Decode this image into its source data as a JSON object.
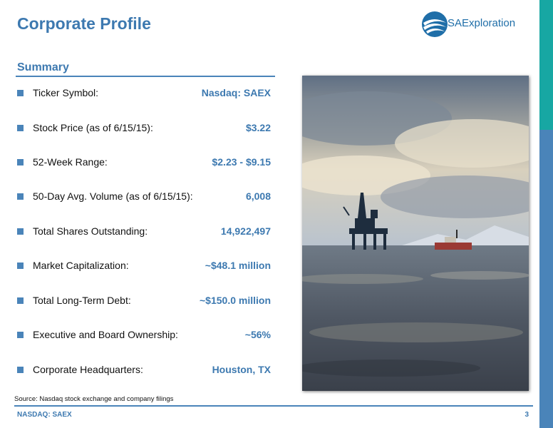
{
  "page": {
    "title": "Corporate Profile",
    "logo_text": "SAExploration",
    "logo_icon": "swoosh-logo-icon"
  },
  "summary": {
    "heading": "Summary",
    "items": [
      {
        "label": "Ticker Symbol:",
        "value": "Nasdaq: SAEX"
      },
      {
        "label": "Stock Price (as of 6/15/15):",
        "value": "$3.22"
      },
      {
        "label": "52-Week Range:",
        "value": "$2.23 - $9.15"
      },
      {
        "label": "50-Day Avg. Volume (as of 6/15/15):",
        "value": "6,008"
      },
      {
        "label": "Total Shares Outstanding:",
        "value": "14,922,497"
      },
      {
        "label": "Market Capitalization:",
        "value": "~$48.1 million"
      },
      {
        "label": "Total Long-Term Debt:",
        "value": "~$150.0 million"
      },
      {
        "label": "Executive and Board Ownership:",
        "value": "~56%"
      },
      {
        "label": "Corporate Headquarters:",
        "value": "Houston, TX"
      }
    ]
  },
  "footer": {
    "source": "Source: Nasdaq stock exchange and company filings",
    "ticker": "NASDAQ: SAEX",
    "page_number": "3"
  },
  "colors": {
    "accent_blue": "#3d79b0",
    "teal": "#17a7a3",
    "rule_blue": "#4a84b9"
  }
}
